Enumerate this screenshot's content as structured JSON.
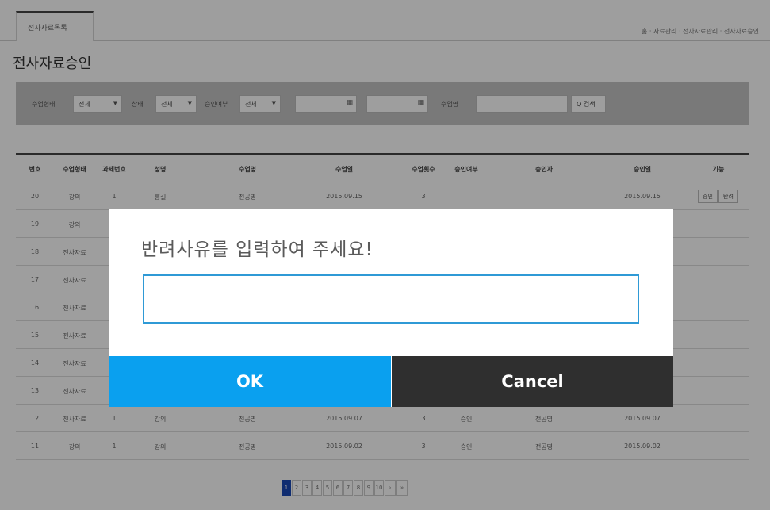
{
  "tab": {
    "label": "전사자료목록"
  },
  "breadcrumb": "홈 · 자료관리 · 전사자료관리 · 전사자료승인",
  "page_title": "전사자료승인",
  "filters": {
    "f1_label": "수업형태",
    "f1_value": "전체",
    "f2_label": "상태",
    "f2_value": "전체",
    "f3_label": "승인여부",
    "f3_value": "전체",
    "date_from": "",
    "date_to": "",
    "f4_label": "수업명",
    "search_value": "",
    "search_button": "Q 검색"
  },
  "table": {
    "headers": [
      "번호",
      "수업형태",
      "과제번호",
      "성명",
      "수업명",
      "수업일",
      "수업횟수",
      "승인여부",
      "승인자",
      "승인일",
      "기능"
    ],
    "rows": [
      [
        "20",
        "강의",
        "1",
        "홍길",
        "전공명",
        "2015.09.15",
        "3",
        "",
        "",
        "2015.09.15",
        "승인|반려"
      ],
      [
        "19",
        "강의",
        "",
        "",
        "",
        "",
        "",
        "",
        "",
        "",
        ""
      ],
      [
        "18",
        "전사자료",
        "",
        "",
        "",
        "",
        "",
        "",
        "",
        "",
        ""
      ],
      [
        "17",
        "전사자료",
        "",
        "",
        "",
        "",
        "",
        "",
        "",
        "",
        ""
      ],
      [
        "16",
        "전사자료",
        "",
        "",
        "",
        "",
        "",
        "",
        "",
        "",
        ""
      ],
      [
        "15",
        "전사자료",
        "",
        "",
        "",
        "",
        "",
        "",
        "",
        "",
        ""
      ],
      [
        "14",
        "전사자료",
        "",
        "",
        "",
        "",
        "",
        "",
        "",
        "",
        ""
      ],
      [
        "13",
        "전사자료",
        "",
        "",
        "",
        "",
        "",
        "",
        "",
        "",
        ""
      ],
      [
        "12",
        "전사자료",
        "1",
        "강의",
        "전공명",
        "2015.09.07",
        "3",
        "승인",
        "전공명",
        "2015.09.07",
        ""
      ],
      [
        "11",
        "강의",
        "1",
        "강의",
        "전공명",
        "2015.09.02",
        "3",
        "승인",
        "전공명",
        "2015.09.02",
        ""
      ]
    ]
  },
  "pagination": {
    "pages": [
      "1",
      "2",
      "3",
      "4",
      "5",
      "6",
      "7",
      "8",
      "9",
      "10"
    ],
    "active": "1",
    "next": "›",
    "last": "»"
  },
  "modal": {
    "title": "반려사유를 입력하여 주세요!",
    "input_value": "",
    "ok_label": "OK",
    "cancel_label": "Cancel"
  },
  "colors": {
    "ok_button": "#0aa0ef",
    "cancel_button": "#2f2f2f",
    "input_border": "#2f9ad6",
    "pagination_active": "#1a49b7"
  }
}
